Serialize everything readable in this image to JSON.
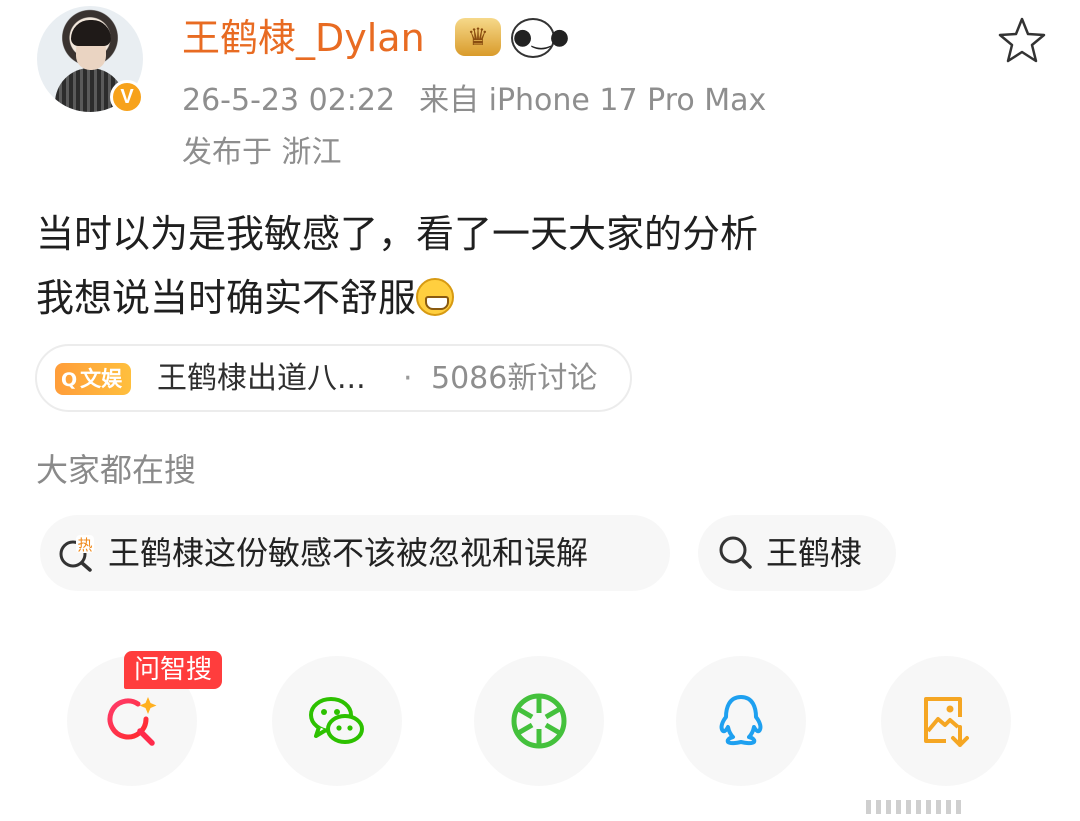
{
  "header": {
    "username": "王鹤棣_Dylan",
    "timestamp": "26-5-23 02:22",
    "source": "来自 iPhone 17 Pro Max",
    "location": "发布于 浙江",
    "badges": [
      "crown-badge-icon",
      "panda-badge-icon"
    ],
    "verified": "V"
  },
  "post": {
    "lines": [
      "当时以为是我敏感了，看了一天大家的分析",
      "我想说当时确实不舒服"
    ]
  },
  "topic_pill": {
    "tag": "文娱",
    "topic": "王鹤棣出道八...",
    "separator": "·",
    "count": "5086新讨论"
  },
  "searching": {
    "title": "大家都在搜",
    "chips": [
      "王鹤棣这份敏感不该被忽视和误解",
      "王鹤棣"
    ],
    "hot_mark": "热"
  },
  "share": {
    "ai_label": "问智搜",
    "icons": [
      "ai-search-icon",
      "wechat-icon",
      "moments-icon",
      "qq-icon",
      "save-image-icon"
    ]
  },
  "colors": {
    "username": "#e86b22",
    "secondary_text": "#8e8e8e",
    "tag_orange": "#ff9d3a",
    "ai_red": "#ff3d3d",
    "wechat_green": "#2dc100",
    "qq_blue": "#1ea0f0",
    "save_orange": "#f5a623"
  }
}
